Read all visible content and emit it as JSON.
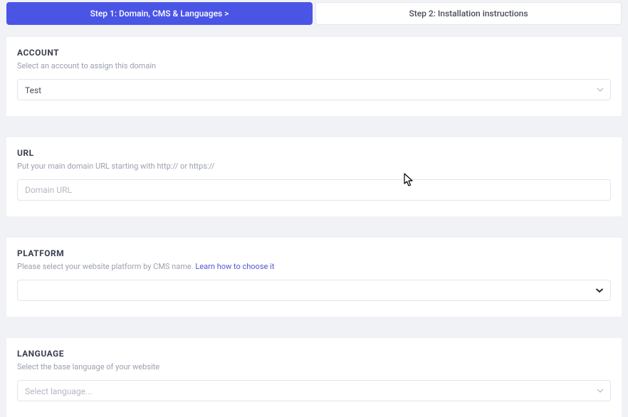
{
  "tabs": {
    "step1": "Step 1: Domain, CMS & Languages  >",
    "step2": "Step 2: Installation instructions"
  },
  "account": {
    "title": "ACCOUNT",
    "description": "Select an account to assign this domain",
    "selected": "Test"
  },
  "url": {
    "title": "URL",
    "description": "Put your main domain URL starting with http:// or https://",
    "placeholder": "Domain URL",
    "value": ""
  },
  "platform": {
    "title": "PLATFORM",
    "description_text": "Please select your website platform by CMS name.  ",
    "link_text": "Learn how to choose it",
    "selected": ""
  },
  "language": {
    "title": "LANGUAGE",
    "description": "Select the base language of your website",
    "placeholder": "Select language..."
  }
}
